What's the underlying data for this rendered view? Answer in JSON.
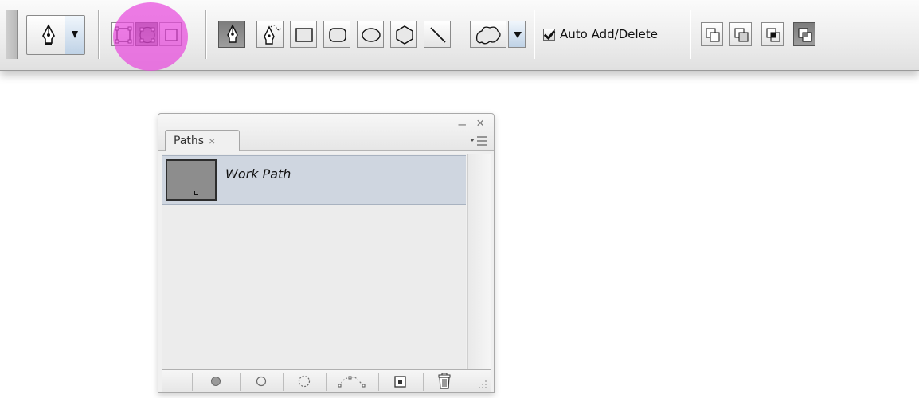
{
  "options_bar": {
    "tool_preset": "pen-tool-preset",
    "mode_buttons": [
      "shape-layers-icon",
      "paths-icon",
      "fill-pixels-icon"
    ],
    "selected_mode": "paths-icon",
    "tool_buttons": [
      "pen-tool-icon",
      "freeform-pen-tool-icon",
      "rectangle-tool-icon",
      "rounded-rectangle-tool-icon",
      "ellipse-tool-icon",
      "polygon-tool-icon",
      "line-tool-icon",
      "custom-shape-tool-icon"
    ],
    "selected_tool": "pen-tool-icon",
    "auto_add_delete": {
      "label": "Auto Add/Delete",
      "checked": true
    },
    "path_operations": [
      "add-to-path-area-icon",
      "subtract-from-path-area-icon",
      "intersect-path-areas-icon",
      "exclude-overlapping-path-areas-icon"
    ],
    "selected_operation": "exclude-overlapping-path-areas-icon",
    "highlight_color": "#e84adc"
  },
  "paths_panel": {
    "tab_label": "Paths",
    "tab_close": "×",
    "minimize_glyph": "–",
    "close_glyph": "×",
    "paths": [
      {
        "name": "Work Path",
        "selected": true
      }
    ],
    "selection_color": "#cfd6e0",
    "footer_buttons": [
      "fill-path-icon",
      "stroke-path-icon",
      "load-path-as-selection-icon",
      "make-work-path-icon",
      "create-new-path-icon",
      "delete-path-icon"
    ]
  }
}
